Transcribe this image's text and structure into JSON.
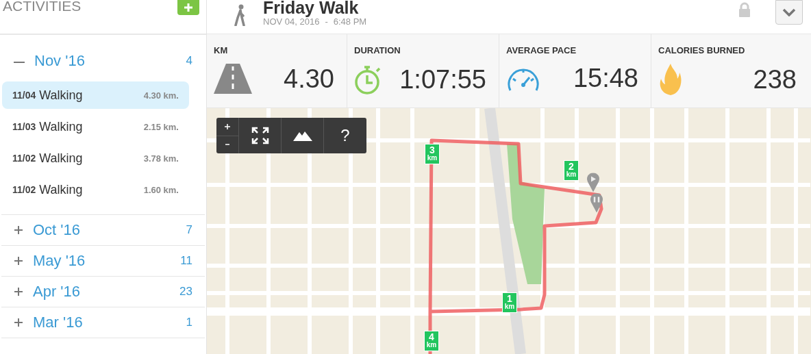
{
  "sidebar": {
    "title": "ACTIVITIES",
    "groups": [
      {
        "label": "Nov '16",
        "count": "4",
        "expanded": true,
        "activities": [
          {
            "date": "11/04",
            "type": "Walking",
            "distance": "4.30 km.",
            "selected": true
          },
          {
            "date": "11/03",
            "type": "Walking",
            "distance": "2.15 km.",
            "selected": false
          },
          {
            "date": "11/02",
            "type": "Walking",
            "distance": "3.78 km.",
            "selected": false
          },
          {
            "date": "11/02",
            "type": "Walking",
            "distance": "1.60 km.",
            "selected": false
          }
        ]
      },
      {
        "label": "Oct '16",
        "count": "7",
        "expanded": false
      },
      {
        "label": "May '16",
        "count": "11",
        "expanded": false
      },
      {
        "label": "Apr '16",
        "count": "23",
        "expanded": false
      },
      {
        "label": "Mar '16",
        "count": "1",
        "expanded": false
      }
    ]
  },
  "header": {
    "title": "Friday Walk",
    "date": "NOV 04, 2016",
    "separator": "-",
    "time": "6:48 PM"
  },
  "stats": [
    {
      "kind": "distance",
      "label": "KM",
      "value": "4.30"
    },
    {
      "kind": "duration",
      "label": "DURATION",
      "value": "1:07:55"
    },
    {
      "kind": "pace",
      "label": "AVERAGE PACE",
      "value": "15:48"
    },
    {
      "kind": "calories",
      "label": "CALORIES BURNED",
      "value": "238"
    }
  ],
  "map": {
    "help_button": "?",
    "markers": [
      {
        "number": "1",
        "unit": "km"
      },
      {
        "number": "2",
        "unit": "km"
      },
      {
        "number": "3",
        "unit": "km"
      },
      {
        "number": "4",
        "unit": "km"
      }
    ]
  }
}
